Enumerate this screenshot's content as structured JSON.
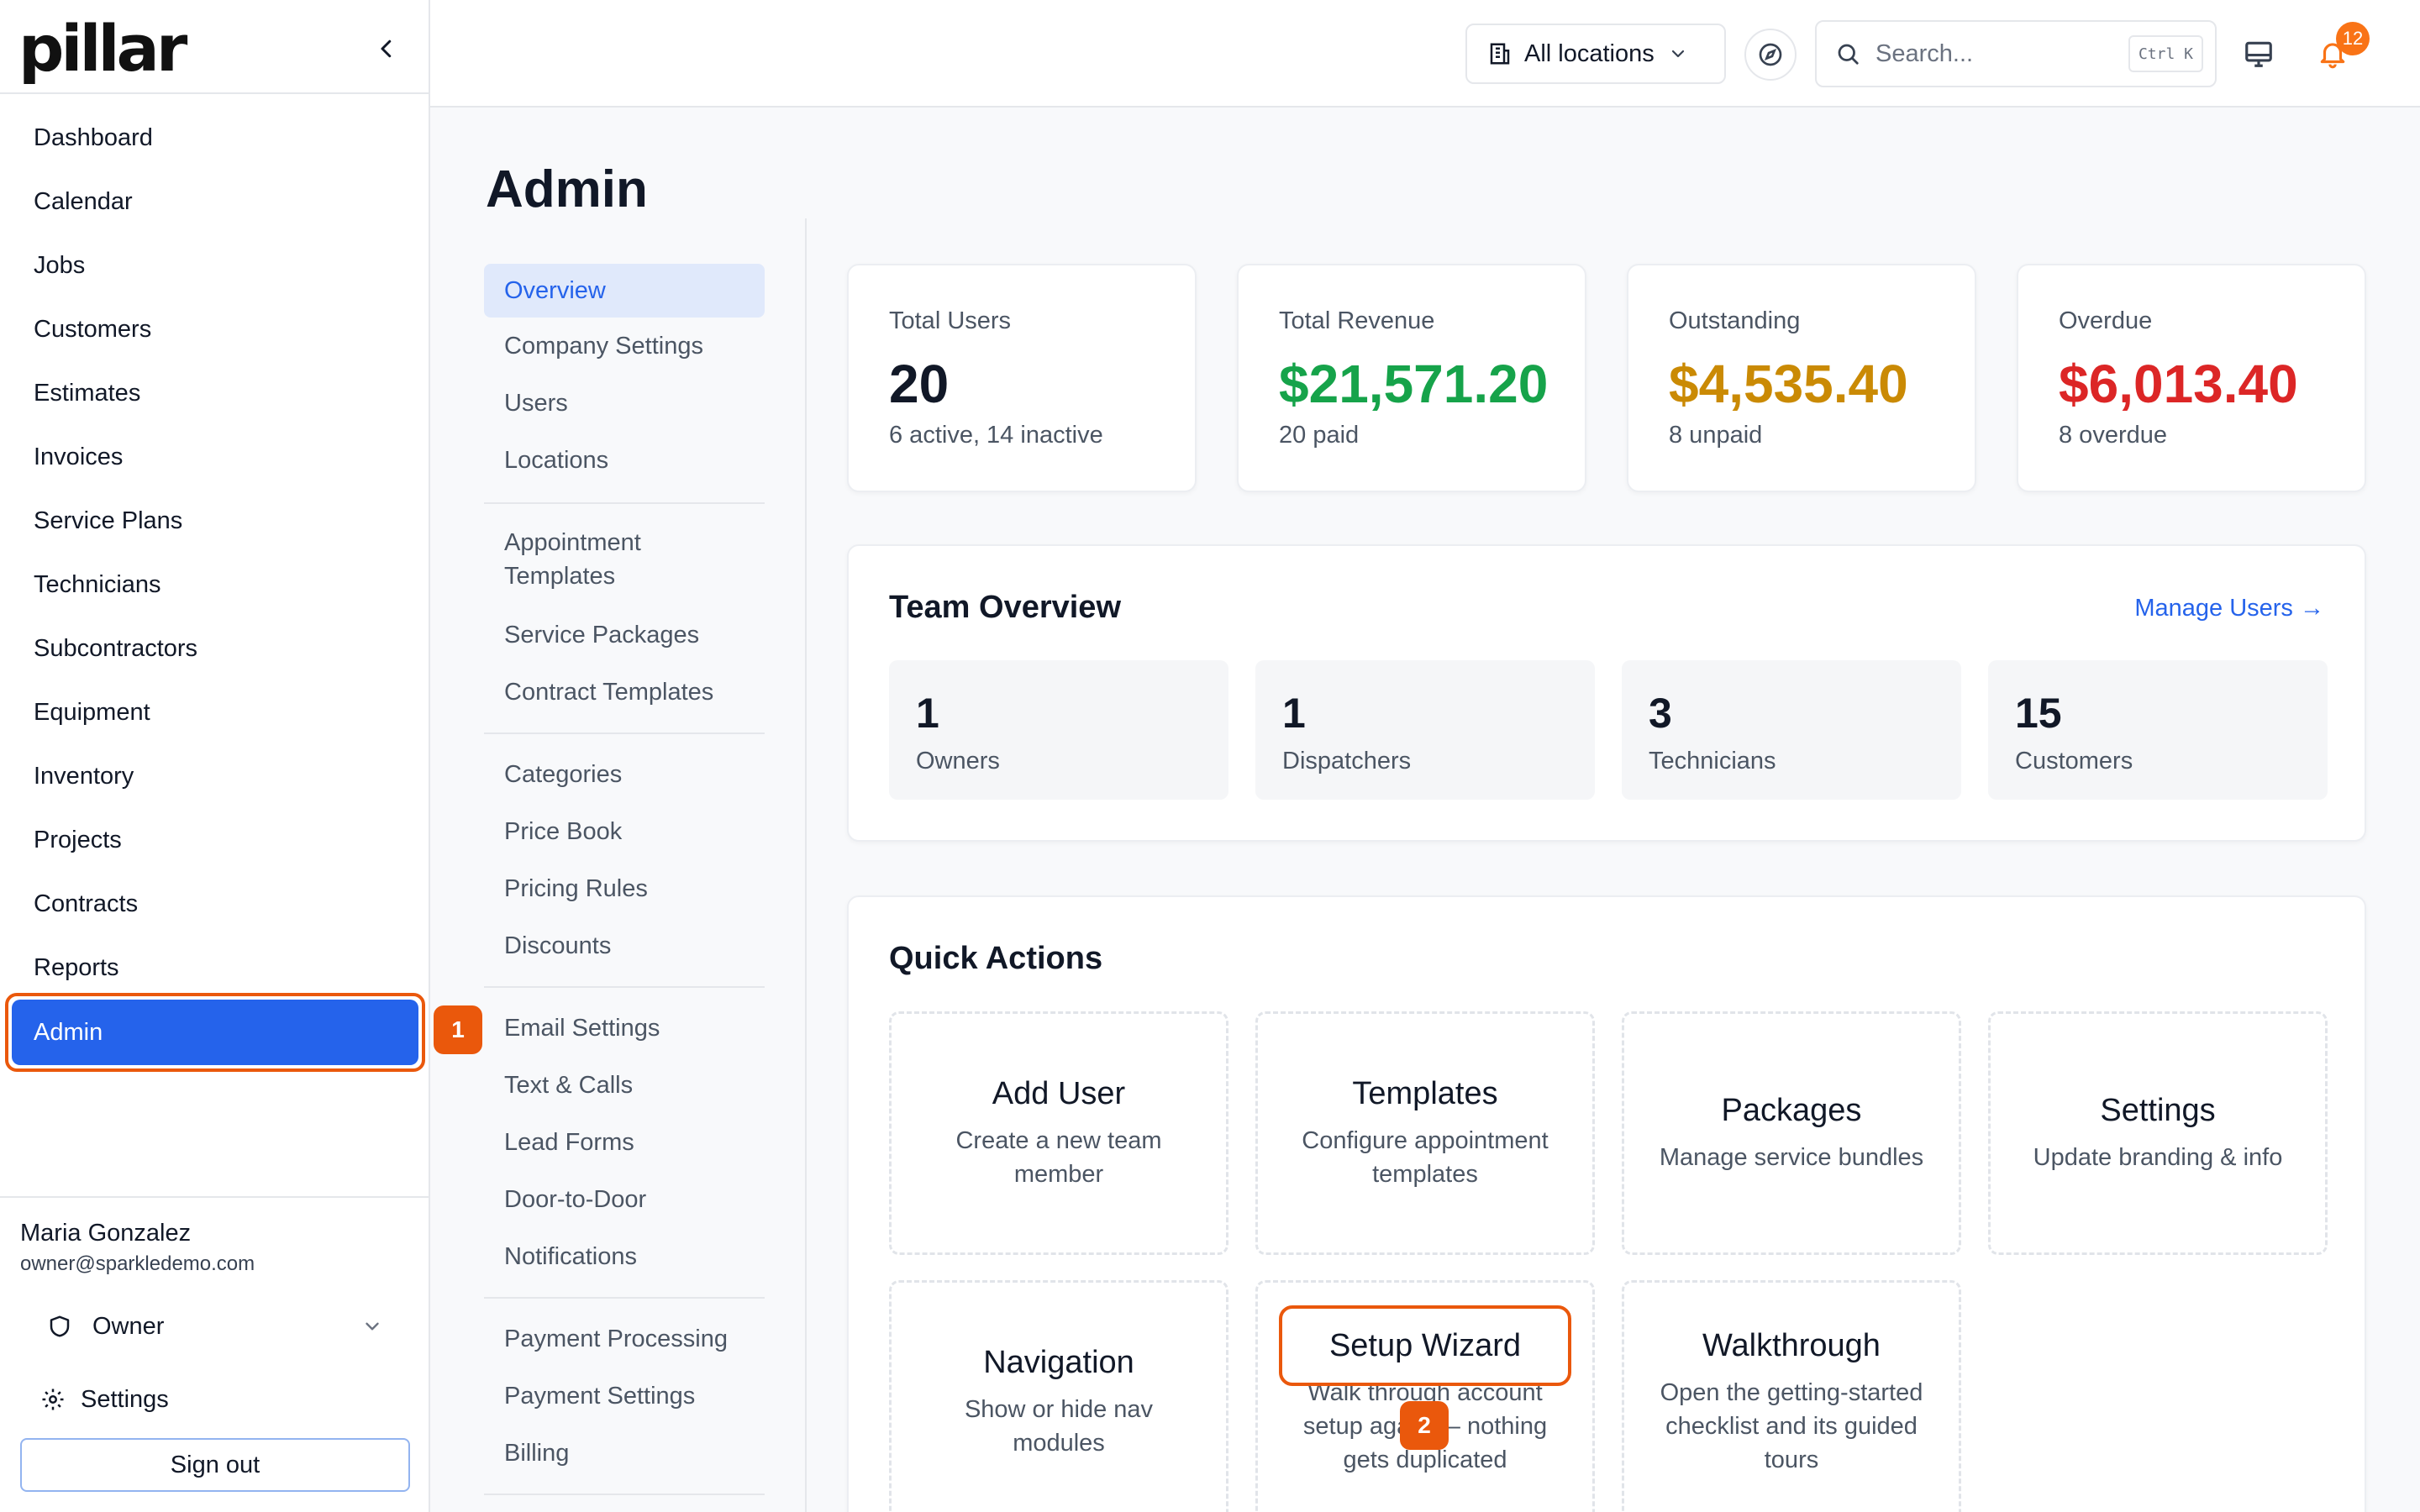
{
  "brand": {
    "logo_text": "pillar"
  },
  "sidebar": {
    "items": [
      {
        "label": "Dashboard"
      },
      {
        "label": "Calendar"
      },
      {
        "label": "Jobs"
      },
      {
        "label": "Customers"
      },
      {
        "label": "Estimates"
      },
      {
        "label": "Invoices"
      },
      {
        "label": "Service Plans"
      },
      {
        "label": "Technicians"
      },
      {
        "label": "Subcontractors"
      },
      {
        "label": "Equipment"
      },
      {
        "label": "Inventory"
      },
      {
        "label": "Projects"
      },
      {
        "label": "Contracts"
      },
      {
        "label": "Reports"
      },
      {
        "label": "Admin",
        "active": true
      }
    ],
    "user": {
      "name": "Maria Gonzalez",
      "email": "owner@sparkledemo.com",
      "role": "Owner"
    },
    "settings_label": "Settings",
    "signout_label": "Sign out"
  },
  "markers": {
    "first": "1",
    "second": "2"
  },
  "topbar": {
    "location_label": "All locations",
    "search_placeholder": "Search...",
    "search_shortcut": "Ctrl K",
    "notification_count": "12"
  },
  "page": {
    "title": "Admin"
  },
  "subnav": {
    "items": [
      "Overview",
      "Company Settings",
      "Users",
      "Locations",
      "Appointment Templates",
      "Service Packages",
      "Contract Templates",
      "Categories",
      "Price Book",
      "Pricing Rules",
      "Discounts",
      "Email Settings",
      "Text & Calls",
      "Lead Forms",
      "Door-to-Door",
      "Notifications",
      "Payment Processing",
      "Payment Settings",
      "Billing"
    ],
    "active": "Overview"
  },
  "stats": [
    {
      "label": "Total Users",
      "value": "20",
      "sub": "6 active, 14 inactive",
      "color": "#111827"
    },
    {
      "label": "Total Revenue",
      "value": "$21,571.20",
      "sub": "20 paid",
      "color": "#16a34a"
    },
    {
      "label": "Outstanding",
      "value": "$4,535.40",
      "sub": "8 unpaid",
      "color": "#ca8a04"
    },
    {
      "label": "Overdue",
      "value": "$6,013.40",
      "sub": "8 overdue",
      "color": "#dc2626"
    }
  ],
  "team": {
    "title": "Team Overview",
    "manage_link": "Manage Users →",
    "tiles": [
      {
        "count": "1",
        "label": "Owners"
      },
      {
        "count": "1",
        "label": "Dispatchers"
      },
      {
        "count": "3",
        "label": "Technicians"
      },
      {
        "count": "15",
        "label": "Customers"
      }
    ]
  },
  "quick_actions": {
    "title": "Quick Actions",
    "items": [
      {
        "title": "Add User",
        "desc": "Create a new team member"
      },
      {
        "title": "Templates",
        "desc": "Configure appointment templates"
      },
      {
        "title": "Packages",
        "desc": "Manage service bundles"
      },
      {
        "title": "Settings",
        "desc": "Update branding & info"
      },
      {
        "title": "Navigation",
        "desc": "Show or hide nav modules"
      },
      {
        "title": "Setup Wizard",
        "desc": "Walk through account setup again — nothing gets duplicated"
      },
      {
        "title": "Walkthrough",
        "desc": "Open the getting-started checklist and its guided tours"
      }
    ]
  },
  "colors": {
    "accent": "#2563eb",
    "highlight": "#ea580c",
    "badge": "#f97316"
  }
}
